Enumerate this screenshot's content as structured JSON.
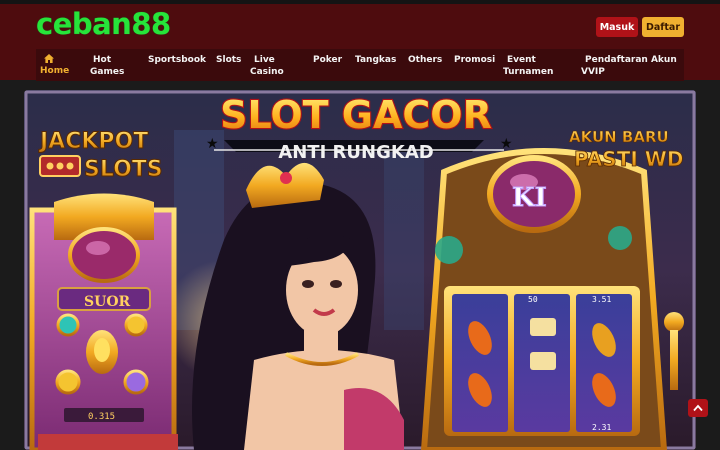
{
  "brand": {
    "logo_text": "ceban88"
  },
  "auth": {
    "login_label": "Masuk",
    "register_label": "Daftar"
  },
  "nav": {
    "items": [
      {
        "line1": "Home",
        "line2": ""
      },
      {
        "line1": "Hot",
        "line2": "Games"
      },
      {
        "line1": "Sportsbook",
        "line2": ""
      },
      {
        "line1": "Slots",
        "line2": ""
      },
      {
        "line1": "Live",
        "line2": "Casino"
      },
      {
        "line1": "Poker",
        "line2": ""
      },
      {
        "line1": "Tangkas",
        "line2": ""
      },
      {
        "line1": "Others",
        "line2": ""
      },
      {
        "line1": "Promosi",
        "line2": ""
      },
      {
        "line1": "Event",
        "line2": "Turnamen"
      },
      {
        "line1": "Pendaftaran Akun",
        "line2": "VVIP"
      }
    ]
  },
  "banner": {
    "title": "SLOT GACOR",
    "subtitle": "ANTI RUNGKAD",
    "left_sign_top": "JACKPOT",
    "left_sign_bottom": "SLOTS",
    "right_sign_top": "AKUN BARU",
    "right_sign_bottom": "PASTI WD",
    "left_machine_label": "SUOR",
    "left_machine_credit": "0.315",
    "right_machine_symbol": "KI",
    "right_machine_values": [
      "50",
      "3.51",
      "2.31"
    ]
  },
  "colors": {
    "header_bg": "#4e0c0e",
    "nav_bg": "#3b0a0c",
    "logo": "#27e43a",
    "accent": "#f0b030",
    "login": "#b01218"
  },
  "icons": {
    "home": "home-icon",
    "back_to_top": "chevron-up-icon"
  }
}
